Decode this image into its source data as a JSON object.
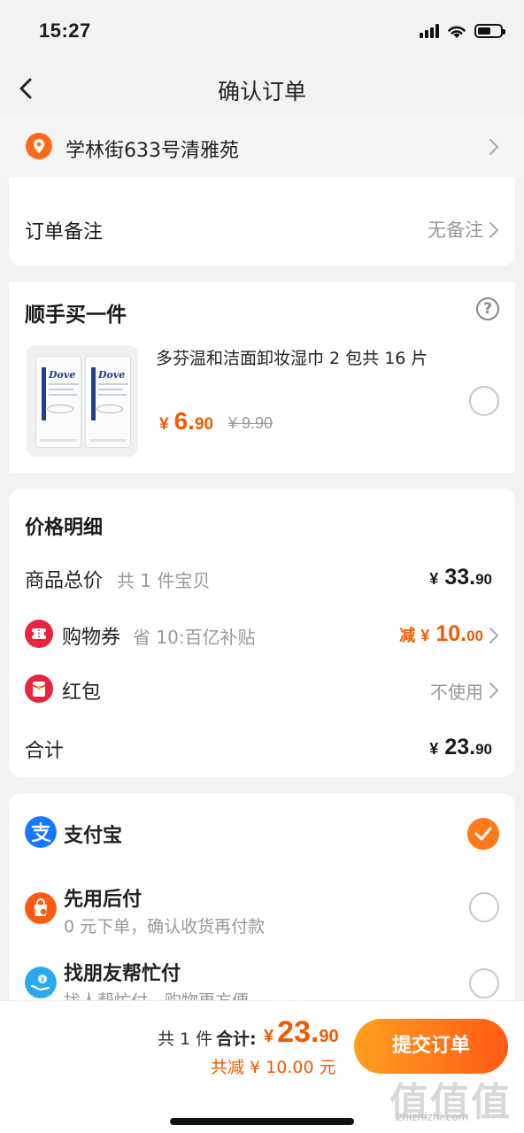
{
  "status_bar": {
    "time": "15:27"
  },
  "nav": {
    "title": "确认订单"
  },
  "address": {
    "text": "学林街633号清雅苑"
  },
  "note": {
    "label": "订单备注",
    "value": "无备注"
  },
  "addon": {
    "title": "顺手买一件",
    "help_glyph": "?",
    "product": {
      "name": "多芬温和洁面卸妆湿巾 2 包共 16 片",
      "image_brand": "Dove",
      "currency": "¥",
      "price_int": "6.",
      "price_dec": "90",
      "original_price": "¥ 9.90"
    }
  },
  "price_detail": {
    "title": "价格明细",
    "subtotal": {
      "label": "商品总价",
      "sub": "共 1 件宝贝",
      "currency": "¥",
      "int": "33.",
      "dec": "90"
    },
    "coupon": {
      "label": "购物券",
      "sub": "省 10:百亿补贴",
      "prefix": "减",
      "currency": "¥",
      "int": "10.",
      "dec": "00"
    },
    "red_packet": {
      "label": "红包",
      "value": "不使用"
    },
    "total": {
      "label": "合计",
      "currency": "¥",
      "int": "23.",
      "dec": "90"
    }
  },
  "payment": {
    "options": [
      {
        "title": "支付宝",
        "sub": "",
        "selected": true
      },
      {
        "title": "先用后付",
        "sub": "0 元下单，确认收货再付款",
        "selected": false
      },
      {
        "title": "找朋友帮忙付",
        "sub": "找人帮忙付，购物更方便",
        "selected": false
      }
    ]
  },
  "bottom": {
    "count": "共 1 件",
    "total_label": "合计:",
    "currency": "¥",
    "int": "23.",
    "dec": "90",
    "discount": "共减 ¥ 10.00 元",
    "submit": "提交订单"
  },
  "watermark": {
    "brand": "值值值",
    "url": "zhizhizhi.com"
  },
  "colors": {
    "accent": "#f15a00",
    "button_start": "#ff9f1f",
    "button_end": "#ff5a14",
    "alipay": "#1677ff",
    "coupon": "#e8243c"
  }
}
